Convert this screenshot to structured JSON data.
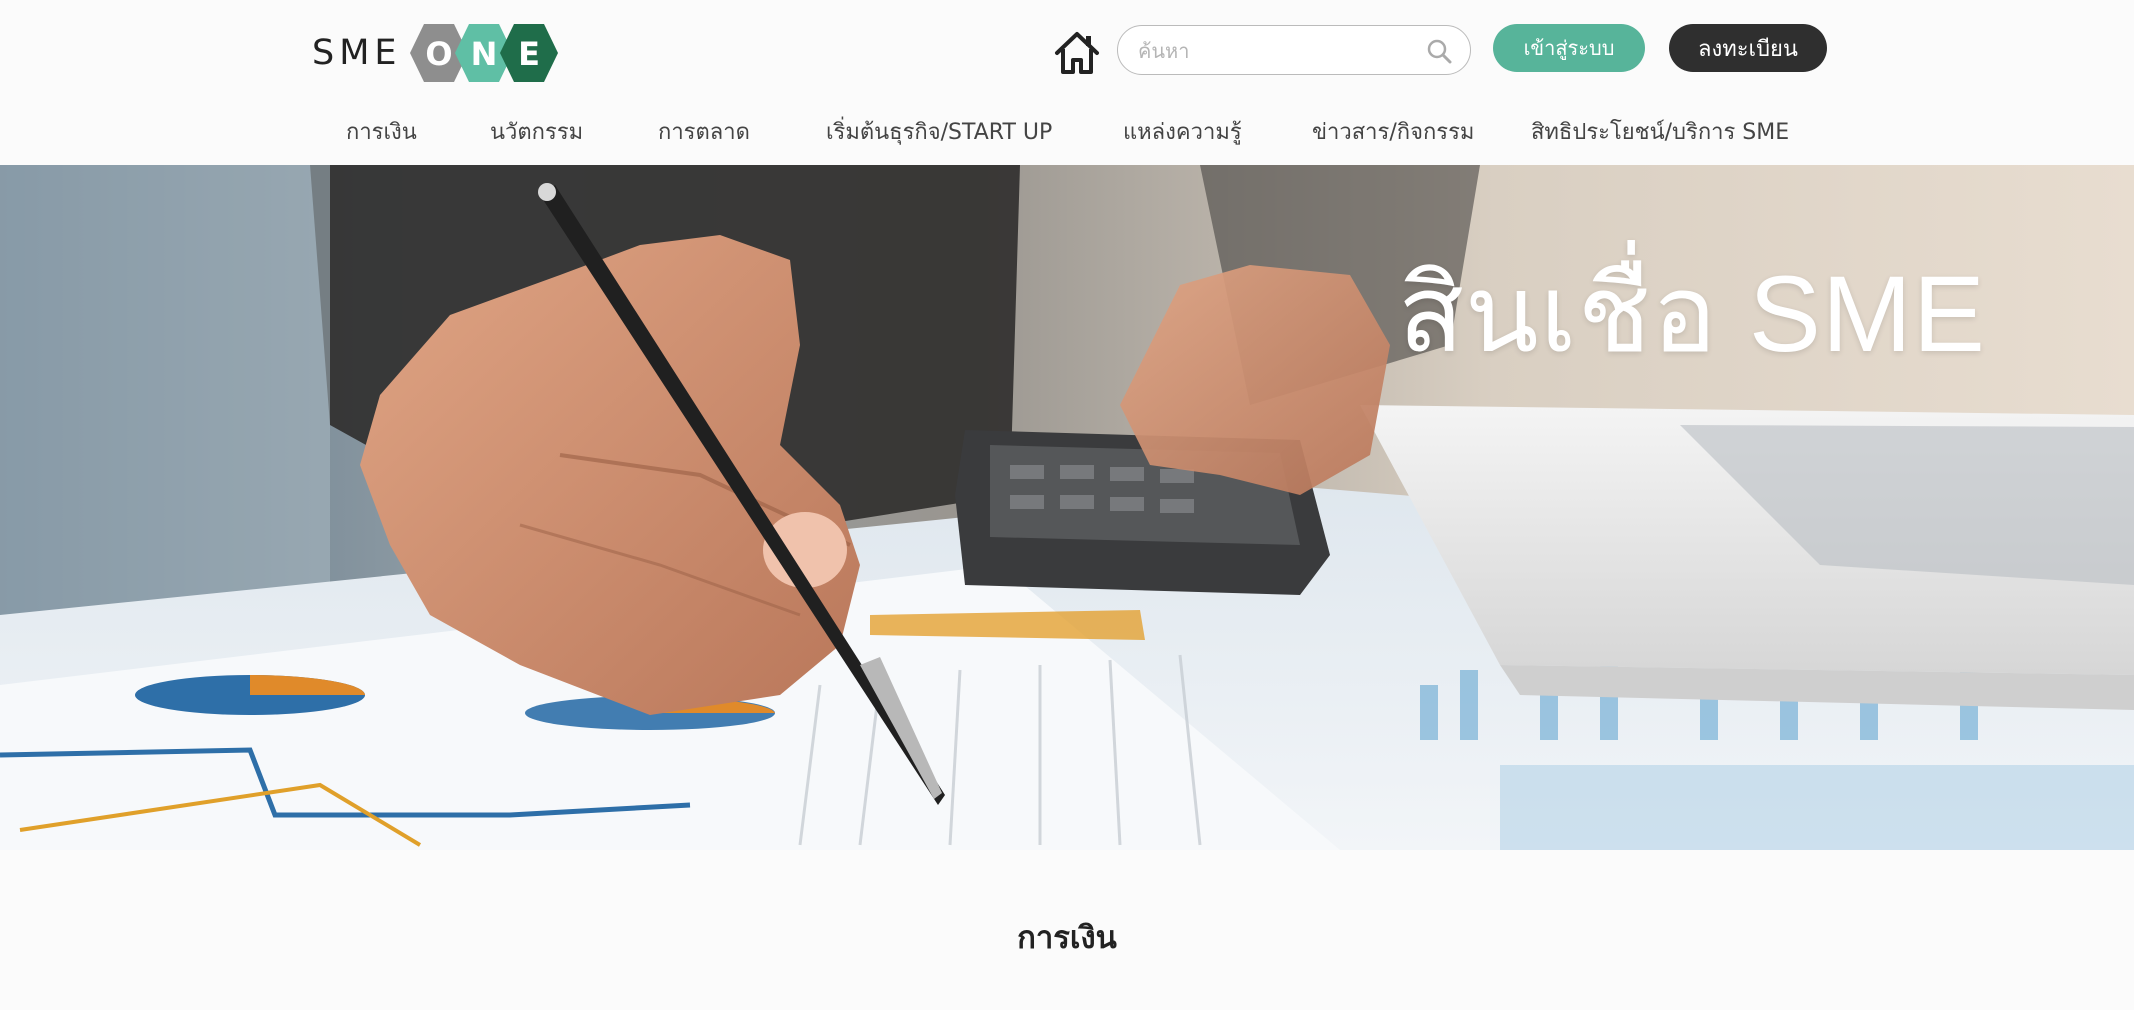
{
  "logo": {
    "text": "SME",
    "hex_letters": [
      "O",
      "N",
      "E"
    ]
  },
  "search": {
    "placeholder": "ค้นหา",
    "value": ""
  },
  "auth": {
    "login_label": "เข้าสู่ระบบ",
    "register_label": "ลงทะเบียน"
  },
  "nav": {
    "items": [
      {
        "label": "การเงิน"
      },
      {
        "label": "นวัตกรรม"
      },
      {
        "label": "การตลาด"
      },
      {
        "label": "เริ่มต้นธุรกิจ/START UP"
      },
      {
        "label": "แหล่งความรู้"
      },
      {
        "label": "ข่าวสาร/กิจกรรม"
      },
      {
        "label": "สิทธิประโยชน์/บริการ SME"
      }
    ]
  },
  "hero": {
    "title": "สินเชื่อ SME"
  },
  "section": {
    "title": "การเงิน"
  },
  "colors": {
    "logo_hex_gray": "#8e8e8e",
    "logo_hex_teal": "#5fbfa5",
    "logo_hex_green": "#1f6d4a",
    "login_button": "#57b49a",
    "register_button": "#2f2f2f"
  },
  "icons": {
    "home": "home-icon",
    "search": "search-icon"
  }
}
